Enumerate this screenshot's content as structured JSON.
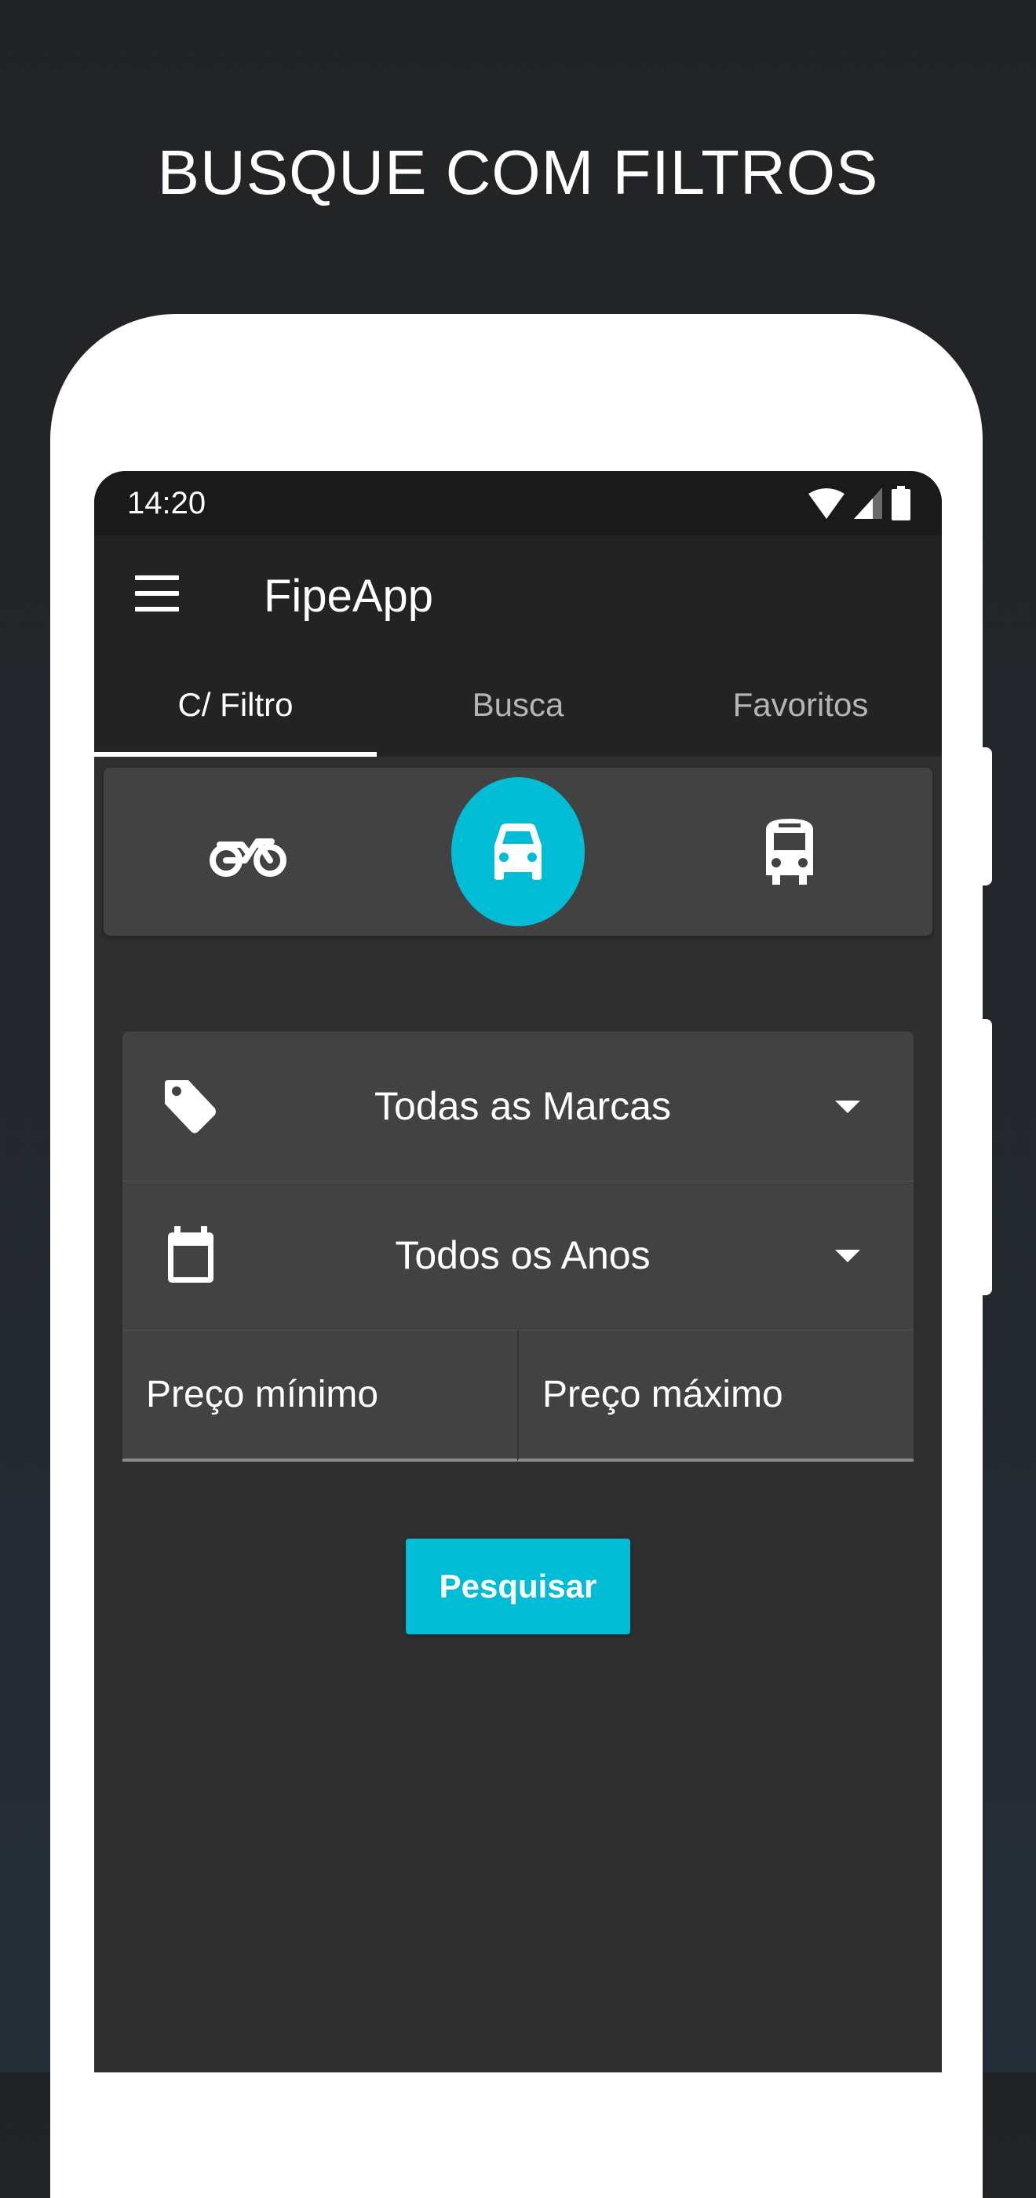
{
  "headline": "BUSQUE COM FILTROS",
  "status_bar": {
    "time": "14:20",
    "icons": [
      "wifi-icon",
      "signal-icon",
      "battery-icon"
    ]
  },
  "app_bar": {
    "title": "FipeApp",
    "menu_icon": "menu-icon"
  },
  "tabs": [
    {
      "label": "C/ Filtro",
      "active": true
    },
    {
      "label": "Busca",
      "active": false
    },
    {
      "label": "Favoritos",
      "active": false
    }
  ],
  "vehicle_types": [
    {
      "icon": "motorcycle-icon",
      "selected": false
    },
    {
      "icon": "car-icon",
      "selected": true
    },
    {
      "icon": "bus-icon",
      "selected": false
    }
  ],
  "filters": {
    "brand": {
      "icon": "tag-icon",
      "value": "Todas as Marcas"
    },
    "year": {
      "icon": "calendar-icon",
      "value": "Todos os Anos"
    },
    "min_price_placeholder": "Preço mínimo",
    "max_price_placeholder": "Preço máximo"
  },
  "search_button": "Pesquisar",
  "colors": {
    "accent": "#00bcd4",
    "background": "#2f2f2f",
    "surface": "#424242",
    "appbar": "#232323"
  }
}
